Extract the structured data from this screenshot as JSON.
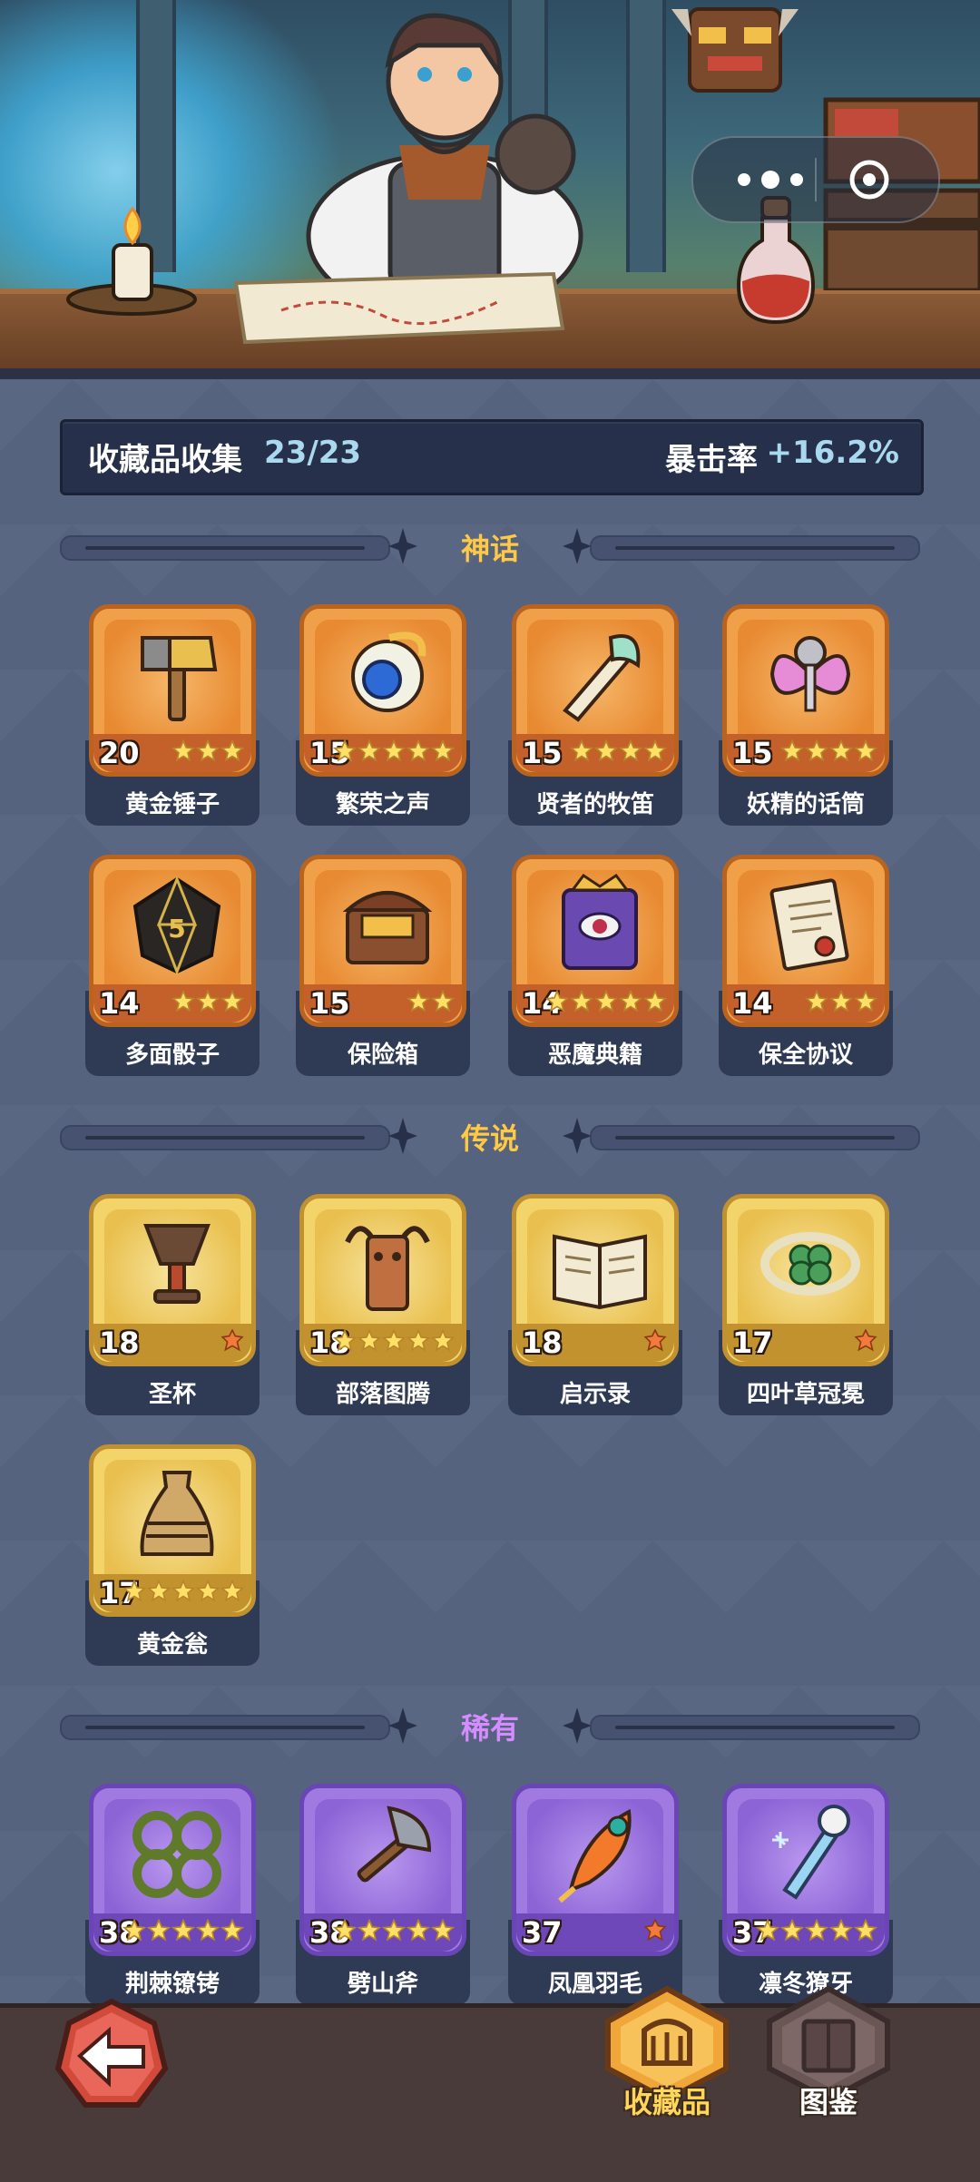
{
  "header": {
    "collection_label": "收藏品收集",
    "collection_count": "23/23",
    "crit_label": "暴击率",
    "crit_value": "+16.2%"
  },
  "sections": [
    {
      "title": "神话",
      "rarity": "mythic",
      "color": "#ffc845",
      "items": [
        {
          "name": "黄金锤子",
          "level": "20",
          "stars": 3,
          "icon": "golden-hammer-icon"
        },
        {
          "name": "繁荣之声",
          "level": "15",
          "stars": 5,
          "icon": "prosperity-orb-icon"
        },
        {
          "name": "贤者的牧笛",
          "level": "15",
          "stars": 4,
          "icon": "sage-flute-icon"
        },
        {
          "name": "妖精的话筒",
          "level": "15",
          "stars": 4,
          "icon": "fairy-microphone-icon"
        },
        {
          "name": "多面骰子",
          "level": "14",
          "stars": 3,
          "icon": "polyhedral-dice-icon"
        },
        {
          "name": "保险箱",
          "level": "15",
          "stars": 2,
          "icon": "treasure-chest-icon"
        },
        {
          "name": "恶魔典籍",
          "level": "14",
          "stars": 5,
          "icon": "demon-tome-icon"
        },
        {
          "name": "保全协议",
          "level": "14",
          "stars": 3,
          "icon": "security-contract-icon"
        }
      ]
    },
    {
      "title": "传说",
      "rarity": "legendary",
      "color": "#ffc845",
      "items": [
        {
          "name": "圣杯",
          "level": "18",
          "stars": 0,
          "icon": "holy-grail-icon"
        },
        {
          "name": "部落图腾",
          "level": "18",
          "stars": 5,
          "icon": "tribal-totem-icon"
        },
        {
          "name": "启示录",
          "level": "18",
          "stars": 0,
          "icon": "revelation-book-icon"
        },
        {
          "name": "四叶草冠冕",
          "level": "17",
          "stars": 0,
          "icon": "clover-crown-icon"
        },
        {
          "name": "黄金瓮",
          "level": "17",
          "stars": 5,
          "icon": "golden-urn-icon"
        }
      ]
    },
    {
      "title": "稀有",
      "rarity": "rare",
      "color": "#d48cff",
      "items": [
        {
          "name": "荆棘镣铐",
          "level": "38",
          "stars": 5,
          "icon": "thorn-shackles-icon"
        },
        {
          "name": "劈山斧",
          "level": "38",
          "stars": 5,
          "icon": "mountain-axe-icon"
        },
        {
          "name": "凤凰羽毛",
          "level": "37",
          "stars": 0,
          "icon": "phoenix-feather-icon"
        },
        {
          "name": "凛冬獠牙",
          "level": "37",
          "stars": 5,
          "icon": "winter-fang-icon"
        }
      ]
    }
  ],
  "nav": {
    "collection_label": "收藏品",
    "codex_label": "图鉴"
  },
  "colors": {
    "mythic_frame": "#f1a04a",
    "legendary_frame": "#f3d46a",
    "rare_frame": "#a07ae0",
    "accent_text": "#a9d8ef"
  }
}
